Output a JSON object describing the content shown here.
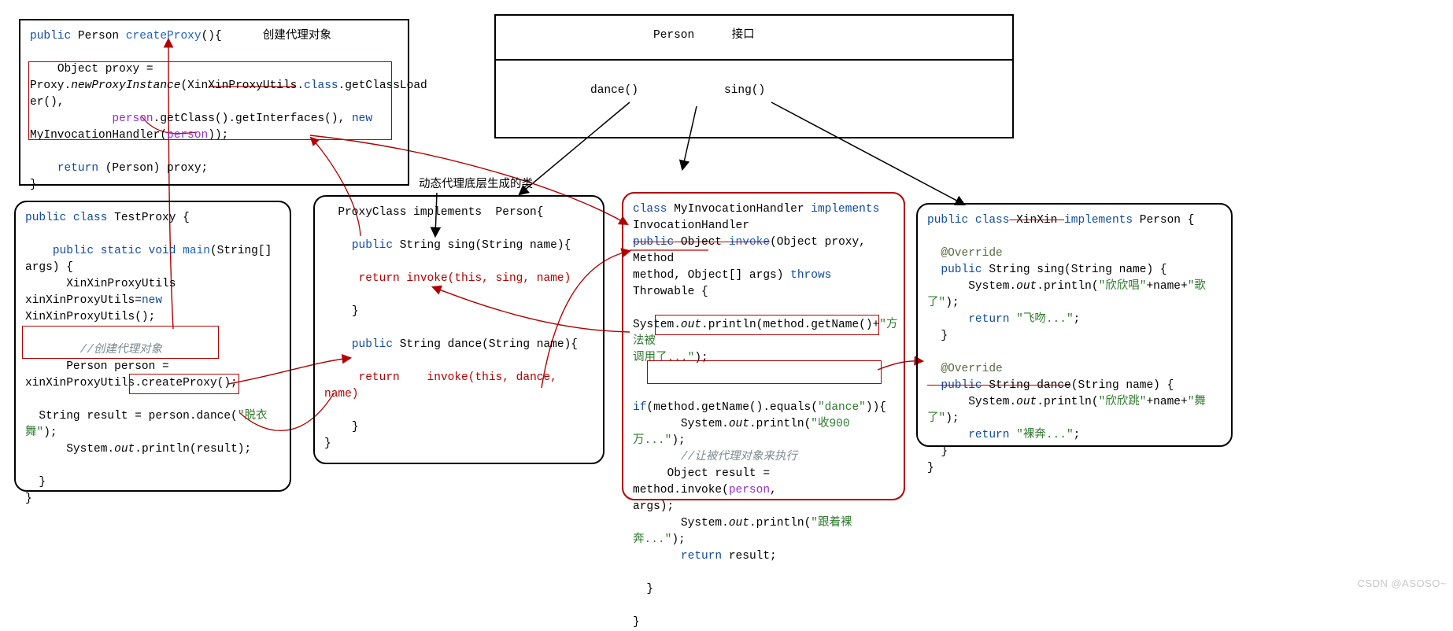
{
  "interface_box": {
    "title_left": "Person",
    "title_right": "接口",
    "method1": "dance()",
    "method2": "sing()"
  },
  "create_proxy": {
    "sig_public": "public",
    "sig_type": "Person",
    "sig_method": "createProxy",
    "sig_rest": "(){",
    "annot": "创建代理对象",
    "l2": "    Object proxy =",
    "l3a": "Proxy.",
    "l3b": "newProxyInstance",
    "l3c": "(XinXinProxyUtils.",
    "l3d": "class",
    "l3e": ".getClassLoad",
    "l4": "er(),",
    "l5a": "            ",
    "l5b": "person",
    "l5c": ".getClass().getInterfaces(), ",
    "l5d": "new",
    "l6a": "MyInvocationHandler(",
    "l6b": "person",
    "l6c": "));",
    "l8a": "    ",
    "l8b": "return",
    "l8c": " (Person) proxy;",
    "l9": "}"
  },
  "test_proxy": {
    "l1_a": "public class",
    "l1_b": " TestProxy {",
    "l3_a": "    public static void",
    "l3_b": " main",
    "l3_c": "(String[]",
    "l4": "args) {",
    "l5": "      XinXinProxyUtils",
    "l6_a": "xinXinProxyUtils=",
    "l6_b": "new",
    "l6_c": " XinXinProxyUtils();",
    "l8": "        //创建代理对象",
    "l9": "      Person person =",
    "l10": "xinXinProxyUtils.createProxy();",
    "l12_a": "  String result = ",
    "l12_b": "person.dance(",
    "l12_c": "\"脱衣",
    "l13_a": "舞\"",
    "l13_b": ");",
    "l14_a": "      System.",
    "l14_b": "out",
    "l14_c": ".println(result);",
    "l16": "  }",
    "l17": "}"
  },
  "dyn_proxy_label": "动态代理底层生成的类",
  "proxy_class": {
    "l1": "  ProxyClass implements  Person{",
    "l3_a": "    public",
    "l3_b": " String sing(String name){",
    "l5_a": "     return",
    "l5_b": " invoke(",
    "l5_c": "this",
    "l5_d": ", sing, name)",
    "l7": "    }",
    "l9_a": "    public",
    "l9_b": " String dance(String name){",
    "l11_a": "     return",
    "l11_b": "    invoke(",
    "l11_c": "this",
    "l11_d": ", dance, name)",
    "l13": "    }",
    "l14": "}"
  },
  "handler": {
    "l1_a": "class",
    "l1_b": " MyInvocationHandler ",
    "l1_c": "implements",
    "l2": "InvocationHandler",
    "l3_a": "public",
    "l3_b": " Object ",
    "l3_c": "invoke",
    "l3_d": "(Object proxy, Method",
    "l4_a": "method, Object[] args) ",
    "l4_b": "throws",
    "l4_c": " Throwable {",
    "l5_a": "    System.",
    "l5_b": "out",
    "l5_c": ".println(method.getName()+",
    "l5_d": "\"方法被",
    "l6_a": "调用了...\"",
    "l6_b": ");",
    "l8_a": "    if",
    "l8_b": "(method.getName().equals(",
    "l8_c": "\"dance\"",
    "l8_d": ")){",
    "l9_a": "       System.",
    "l9_b": "out",
    "l9_c": ".println(",
    "l9_d": "\"收900万...\"",
    "l9_e": ");",
    "l10": "       //让被代理对象来执行",
    "l11_a": "     Object result = method.invoke(",
    "l11_b": "person",
    "l11_c": ",",
    "l12": "args);",
    "l13_a": "       System.",
    "l13_b": "out",
    "l13_c": ".println(",
    "l13_d": "\"跟着裸奔...\"",
    "l13_e": ");",
    "l14_a": "       return",
    "l14_b": " result;",
    "l16": "  }",
    "l18": "}"
  },
  "xinxin": {
    "l1_a": "public class",
    "l1_b": " XinXin ",
    "l1_c": "implements",
    "l1_d": " Person {",
    "l3": "  @Override",
    "l4_a": "  public",
    "l4_b": " String sing(String name) {",
    "l5_a": "      System.",
    "l5_b": "out",
    "l5_c": ".println(",
    "l5_d": "\"欣欣唱\"",
    "l5_e": "+name+",
    "l5_f": "\"歌了\"",
    "l5_g": ");",
    "l6_a": "      return",
    "l6_b": " \"飞吻...\"",
    "l6_c": ";",
    "l7": "  }",
    "l9": "  @Override",
    "l10_a": "  public",
    "l10_b": " String ",
    "l10_c": "dance",
    "l10_d": "(String name) {",
    "l11_a": "      System.",
    "l11_b": "out",
    "l11_c": ".println(",
    "l11_d": "\"欣欣跳\"",
    "l11_e": "+name+",
    "l11_f": "\"舞了\"",
    "l11_g": ");",
    "l12_a": "      return",
    "l12_b": " \"裸奔...\"",
    "l12_c": ";",
    "l13": "  }",
    "l14": "}"
  },
  "watermark": "CSDN @ASOSO~"
}
